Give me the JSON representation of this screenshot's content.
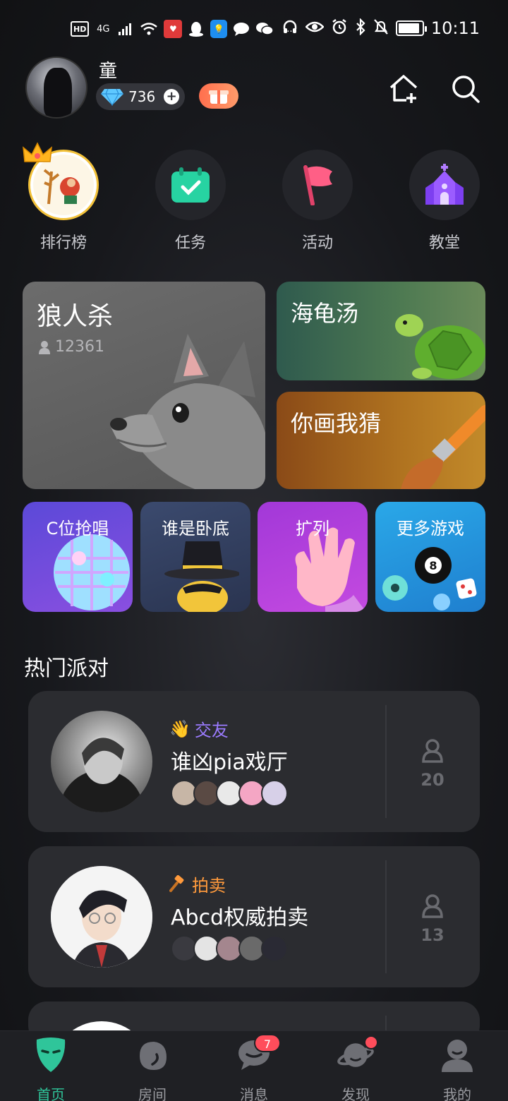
{
  "status_bar": {
    "left_icons": [
      "HD",
      "4G",
      "signal",
      "wifi",
      "red-app",
      "qq",
      "blue-app",
      "chat",
      "wechat",
      "..."
    ],
    "time": "10:11",
    "battery_level": 0.9
  },
  "header": {
    "username": "童",
    "diamonds": "736"
  },
  "quick_actions": [
    {
      "label": "排行榜",
      "icon": "leaderboard-icon"
    },
    {
      "label": "任务",
      "icon": "task-icon"
    },
    {
      "label": "活动",
      "icon": "flag-icon"
    },
    {
      "label": "教堂",
      "icon": "church-icon"
    }
  ],
  "games": {
    "werewolf": {
      "title": "狼人杀",
      "players": "12361"
    },
    "turtle_soup": {
      "title": "海龟汤"
    },
    "draw_guess": {
      "title": "你画我猜"
    },
    "small": [
      {
        "title": "C位抢唱"
      },
      {
        "title": "谁是卧底"
      },
      {
        "title": "扩列"
      },
      {
        "title": "更多游戏"
      }
    ]
  },
  "hot_party": {
    "title": "热门派对",
    "rooms": [
      {
        "tag": "交友",
        "tag_color": "#9b7bff",
        "name": "谁凶pia戏厅",
        "count": "20"
      },
      {
        "tag": "拍卖",
        "tag_color": "#ff9a3c",
        "name": "Abcd权威拍卖",
        "count": "13"
      }
    ]
  },
  "bottom_nav": [
    {
      "label": "首页",
      "active": true
    },
    {
      "label": "房间"
    },
    {
      "label": "消息",
      "badge": "7"
    },
    {
      "label": "发现"
    },
    {
      "label": "我的"
    }
  ],
  "colors": {
    "accent": "#2fc59a",
    "badge": "#ff4d5b"
  }
}
